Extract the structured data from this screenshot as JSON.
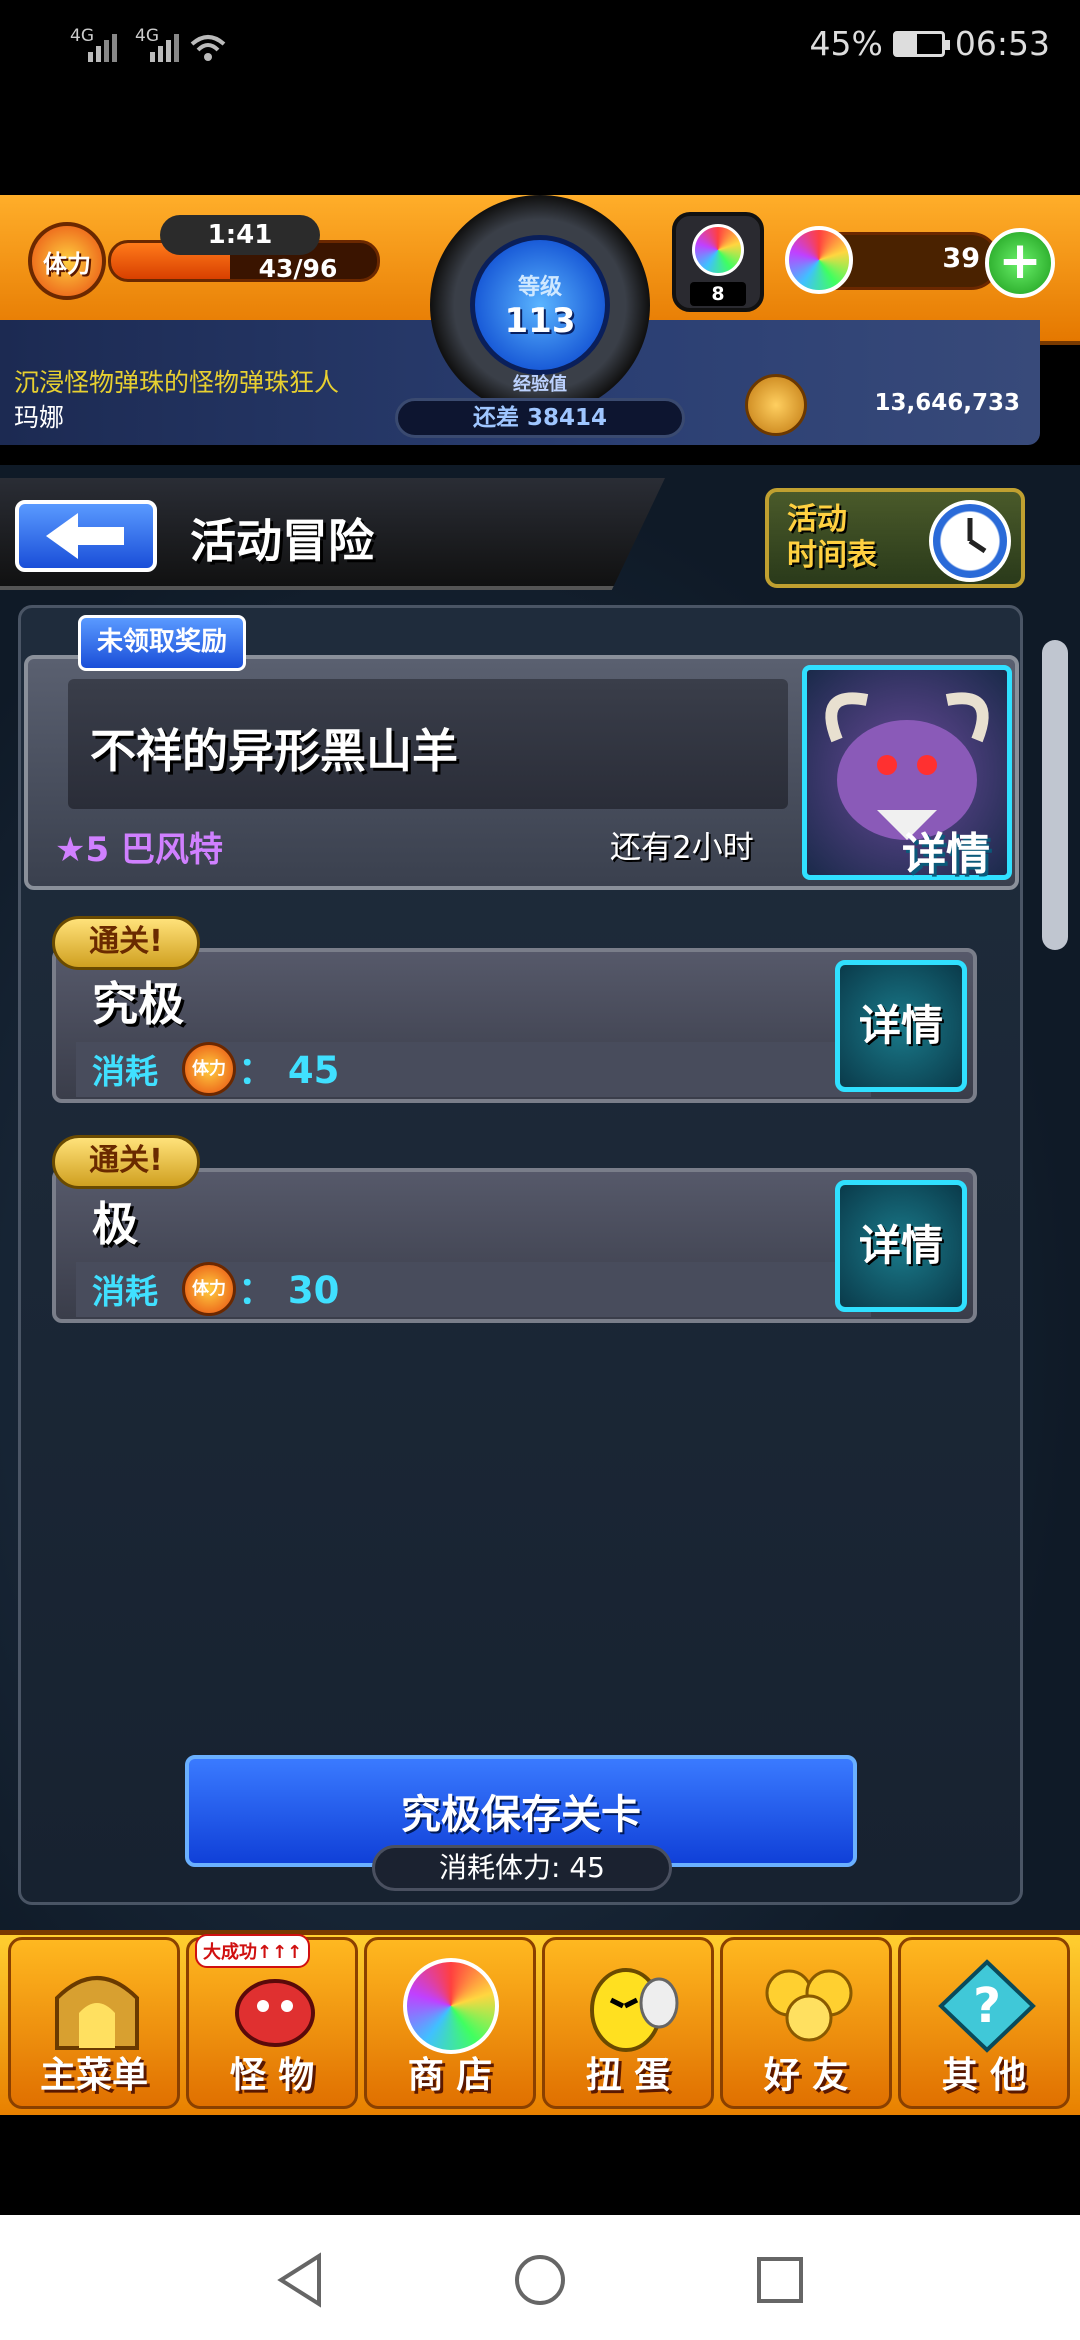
{
  "status_bar": {
    "signal1": "4G",
    "signal2": "4G",
    "battery": "45%",
    "time": "06:53"
  },
  "hud": {
    "stamina_icon_label": "体力",
    "stamina_timer": "1:41",
    "stamina_value": "43/96",
    "stamina_fraction": 0.448,
    "level_label": "等级",
    "level_value": "113",
    "exp_label": "经验值",
    "exp_remaining": "还差 38414",
    "orb_stock": "8",
    "gem_count": "39",
    "coin_count": "13,646,733"
  },
  "ticker": {
    "line1": "沉浸怪物弹珠的怪物弹珠狂人",
    "line2": "玛娜"
  },
  "header": {
    "title": "活动冒险",
    "schedule_label_1": "活动",
    "schedule_label_2": "时间表"
  },
  "event": {
    "reward_tag": "未领取奖励",
    "title": "不祥的异形黑山羊",
    "element": "★5 巴风特",
    "remaining": "还有2小时",
    "detail_label": "详情"
  },
  "quests": [
    {
      "clear_tag": "通关!",
      "name": "究极",
      "cost_label": "消耗",
      "cost_icon": "体力",
      "cost": "： 45",
      "detail": "详情"
    },
    {
      "clear_tag": "通关!",
      "name": "极",
      "cost_label": "消耗",
      "cost_icon": "体力",
      "cost": "： 30",
      "detail": "详情"
    }
  ],
  "save": {
    "label": "究极保存关卡",
    "sub": "消耗体力:  45"
  },
  "bottom_nav": [
    {
      "label": "主菜单",
      "icon": "castle-gate-icon"
    },
    {
      "label": "怪 物",
      "icon": "red-dragon-icon",
      "badge": "大成功↑↑↑"
    },
    {
      "label": "商 店",
      "icon": "rainbow-orb-icon"
    },
    {
      "label": "扭 蛋",
      "icon": "yellow-egg-icon"
    },
    {
      "label": "好 友",
      "icon": "friends-balloon-icon"
    },
    {
      "label": "其 他",
      "icon": "question-diamond-icon"
    }
  ]
}
